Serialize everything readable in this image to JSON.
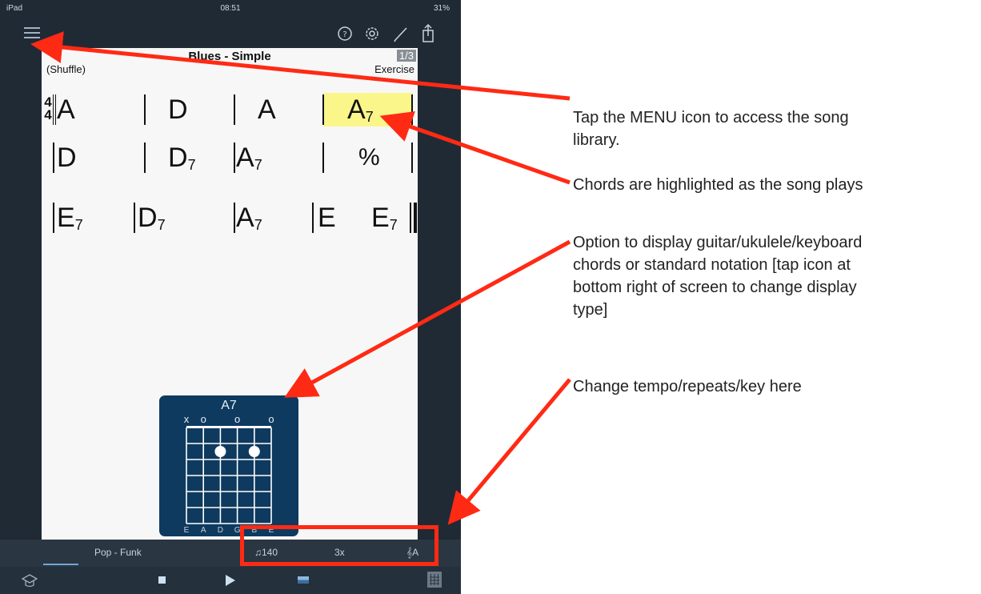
{
  "status_bar": {
    "device": "iPad",
    "time": "08:51",
    "battery": "31%"
  },
  "toolbar": {
    "icons": [
      "menu-icon",
      "help-icon",
      "gear-icon",
      "pencil-icon",
      "share-icon"
    ]
  },
  "song": {
    "title": "Blues - Simple",
    "style": "(Shuffle)",
    "page": "1/3",
    "category": "Exercise",
    "time_signature": {
      "top": "4",
      "bottom": "4"
    },
    "rows": [
      [
        {
          "root": "A",
          "ext": ""
        },
        {
          "root": "D",
          "ext": ""
        },
        {
          "root": "A",
          "ext": ""
        },
        {
          "root": "A",
          "ext": "7"
        }
      ],
      [
        {
          "root": "D",
          "ext": ""
        },
        {
          "root": "D",
          "ext": "7"
        },
        {
          "root": "A",
          "ext": "7"
        },
        {
          "root": "%",
          "ext": ""
        }
      ],
      [
        {
          "root": "E",
          "ext": "7"
        },
        {
          "root": "D",
          "ext": "7"
        },
        {
          "root": "A",
          "ext": "7"
        },
        {
          "root": "E",
          "ext": ""
        },
        {
          "root": "E",
          "ext": "7"
        }
      ]
    ]
  },
  "chord_diagram": {
    "name": "A7",
    "string_markers": [
      "x",
      "o",
      "",
      "o",
      "",
      "o"
    ],
    "strings": [
      "E",
      "A",
      "D",
      "G",
      "B",
      "E"
    ],
    "dots": [
      {
        "string": 3,
        "fret": 2
      },
      {
        "string": 5,
        "fret": 2
      }
    ]
  },
  "bottom_bar": {
    "style": "Pop - Funk",
    "tempo": "140",
    "repeats": "3x",
    "key": "A",
    "controls": [
      "lessons-icon",
      "stop-icon",
      "play-icon",
      "mixer-icon",
      "chord-grid-icon"
    ]
  },
  "annotations": {
    "menu": [
      "Tap the MENU icon to access the song",
      "library."
    ],
    "highlight": [
      "Chords are highlighted as the song plays"
    ],
    "display": [
      "Option to display guitar/ukulele/keyboard",
      "chords or standard notation [tap icon at",
      "bottom right of screen to change display",
      "type]"
    ],
    "tempo": [
      "Change tempo/repeats/key here"
    ]
  },
  "colors": {
    "highlight": "#fbf68a",
    "arrow": "#ff2a14",
    "diagram_bg": "#0e3a5f",
    "frame": "#1f2a35"
  }
}
